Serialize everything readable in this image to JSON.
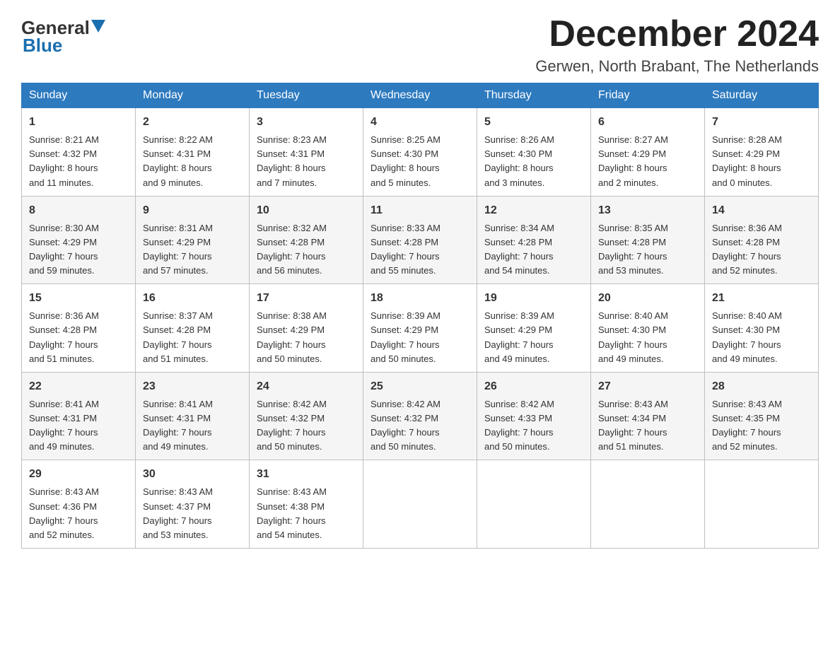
{
  "logo": {
    "text_general": "General",
    "text_blue": "Blue",
    "aria": "GeneralBlue logo"
  },
  "title": {
    "month_year": "December 2024",
    "location": "Gerwen, North Brabant, The Netherlands"
  },
  "weekdays": [
    "Sunday",
    "Monday",
    "Tuesday",
    "Wednesday",
    "Thursday",
    "Friday",
    "Saturday"
  ],
  "weeks": [
    [
      {
        "day": "1",
        "sunrise": "8:21 AM",
        "sunset": "4:32 PM",
        "daylight": "8 hours and 11 minutes."
      },
      {
        "day": "2",
        "sunrise": "8:22 AM",
        "sunset": "4:31 PM",
        "daylight": "8 hours and 9 minutes."
      },
      {
        "day": "3",
        "sunrise": "8:23 AM",
        "sunset": "4:31 PM",
        "daylight": "8 hours and 7 minutes."
      },
      {
        "day": "4",
        "sunrise": "8:25 AM",
        "sunset": "4:30 PM",
        "daylight": "8 hours and 5 minutes."
      },
      {
        "day": "5",
        "sunrise": "8:26 AM",
        "sunset": "4:30 PM",
        "daylight": "8 hours and 3 minutes."
      },
      {
        "day": "6",
        "sunrise": "8:27 AM",
        "sunset": "4:29 PM",
        "daylight": "8 hours and 2 minutes."
      },
      {
        "day": "7",
        "sunrise": "8:28 AM",
        "sunset": "4:29 PM",
        "daylight": "8 hours and 0 minutes."
      }
    ],
    [
      {
        "day": "8",
        "sunrise": "8:30 AM",
        "sunset": "4:29 PM",
        "daylight": "7 hours and 59 minutes."
      },
      {
        "day": "9",
        "sunrise": "8:31 AM",
        "sunset": "4:29 PM",
        "daylight": "7 hours and 57 minutes."
      },
      {
        "day": "10",
        "sunrise": "8:32 AM",
        "sunset": "4:28 PM",
        "daylight": "7 hours and 56 minutes."
      },
      {
        "day": "11",
        "sunrise": "8:33 AM",
        "sunset": "4:28 PM",
        "daylight": "7 hours and 55 minutes."
      },
      {
        "day": "12",
        "sunrise": "8:34 AM",
        "sunset": "4:28 PM",
        "daylight": "7 hours and 54 minutes."
      },
      {
        "day": "13",
        "sunrise": "8:35 AM",
        "sunset": "4:28 PM",
        "daylight": "7 hours and 53 minutes."
      },
      {
        "day": "14",
        "sunrise": "8:36 AM",
        "sunset": "4:28 PM",
        "daylight": "7 hours and 52 minutes."
      }
    ],
    [
      {
        "day": "15",
        "sunrise": "8:36 AM",
        "sunset": "4:28 PM",
        "daylight": "7 hours and 51 minutes."
      },
      {
        "day": "16",
        "sunrise": "8:37 AM",
        "sunset": "4:28 PM",
        "daylight": "7 hours and 51 minutes."
      },
      {
        "day": "17",
        "sunrise": "8:38 AM",
        "sunset": "4:29 PM",
        "daylight": "7 hours and 50 minutes."
      },
      {
        "day": "18",
        "sunrise": "8:39 AM",
        "sunset": "4:29 PM",
        "daylight": "7 hours and 50 minutes."
      },
      {
        "day": "19",
        "sunrise": "8:39 AM",
        "sunset": "4:29 PM",
        "daylight": "7 hours and 49 minutes."
      },
      {
        "day": "20",
        "sunrise": "8:40 AM",
        "sunset": "4:30 PM",
        "daylight": "7 hours and 49 minutes."
      },
      {
        "day": "21",
        "sunrise": "8:40 AM",
        "sunset": "4:30 PM",
        "daylight": "7 hours and 49 minutes."
      }
    ],
    [
      {
        "day": "22",
        "sunrise": "8:41 AM",
        "sunset": "4:31 PM",
        "daylight": "7 hours and 49 minutes."
      },
      {
        "day": "23",
        "sunrise": "8:41 AM",
        "sunset": "4:31 PM",
        "daylight": "7 hours and 49 minutes."
      },
      {
        "day": "24",
        "sunrise": "8:42 AM",
        "sunset": "4:32 PM",
        "daylight": "7 hours and 50 minutes."
      },
      {
        "day": "25",
        "sunrise": "8:42 AM",
        "sunset": "4:32 PM",
        "daylight": "7 hours and 50 minutes."
      },
      {
        "day": "26",
        "sunrise": "8:42 AM",
        "sunset": "4:33 PM",
        "daylight": "7 hours and 50 minutes."
      },
      {
        "day": "27",
        "sunrise": "8:43 AM",
        "sunset": "4:34 PM",
        "daylight": "7 hours and 51 minutes."
      },
      {
        "day": "28",
        "sunrise": "8:43 AM",
        "sunset": "4:35 PM",
        "daylight": "7 hours and 52 minutes."
      }
    ],
    [
      {
        "day": "29",
        "sunrise": "8:43 AM",
        "sunset": "4:36 PM",
        "daylight": "7 hours and 52 minutes."
      },
      {
        "day": "30",
        "sunrise": "8:43 AM",
        "sunset": "4:37 PM",
        "daylight": "7 hours and 53 minutes."
      },
      {
        "day": "31",
        "sunrise": "8:43 AM",
        "sunset": "4:38 PM",
        "daylight": "7 hours and 54 minutes."
      },
      null,
      null,
      null,
      null
    ]
  ],
  "labels": {
    "sunrise": "Sunrise:",
    "sunset": "Sunset:",
    "daylight": "Daylight:"
  }
}
